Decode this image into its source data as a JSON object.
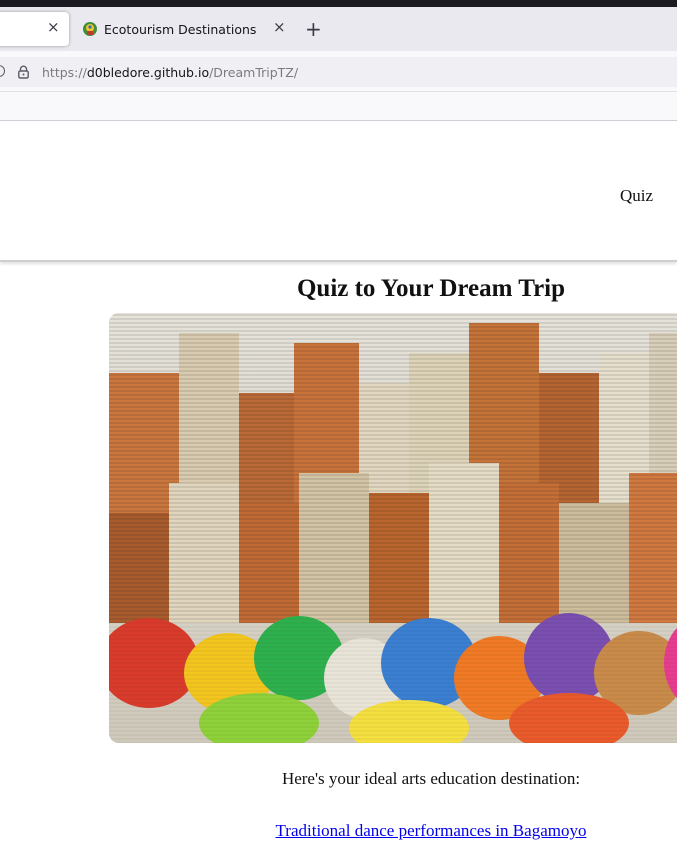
{
  "browser": {
    "tabs": [
      {
        "label": "",
        "active": true
      },
      {
        "label": "Ecotourism Destinations",
        "active": false
      }
    ],
    "address": {
      "scheme": "https://",
      "host": "d0bledore.github.io",
      "path": "/DreamTripTZ/"
    },
    "icons": {
      "tab_close": "close-icon",
      "new_tab": "plus-icon",
      "lock": "lock-icon"
    }
  },
  "page": {
    "nav": {
      "quiz_label": "Quiz"
    },
    "title": "Quiz to Your Dream Trip",
    "hero_image": "colorful-yarn-spools-photo",
    "result_text": "Here's your ideal arts education destination:",
    "result_link": "Traditional dance performances in Bagamoyo"
  },
  "colors": {
    "link": "#0000ee",
    "header_border": "#cfcfcf",
    "tabstrip": "#eae9ef"
  }
}
